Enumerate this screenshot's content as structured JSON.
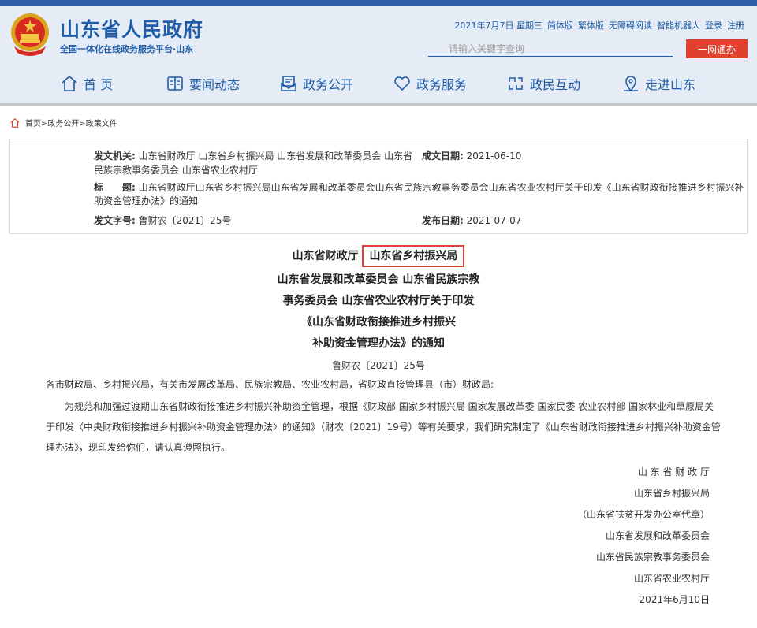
{
  "header": {
    "site_title": "山东省人民政府",
    "site_subtitle": "全国一体化在线政务服务平台·山东",
    "toplinks": [
      "2021年7月7日 星期三",
      "简体版",
      "繁体版",
      "无障碍阅读",
      "智能机器人",
      "登录",
      "注册"
    ],
    "search_placeholder": "请输入关键字查询",
    "search_button": "一网通办",
    "colors": {
      "brand": "#1f5da9",
      "accent": "#e0412f",
      "topbar": "#2e5da6"
    }
  },
  "nav": [
    {
      "label": "首 页",
      "icon": "home-icon"
    },
    {
      "label": "要闻动态",
      "icon": "newspaper-icon"
    },
    {
      "label": "政务公开",
      "icon": "document-open-icon"
    },
    {
      "label": "政务服务",
      "icon": "heart-icon"
    },
    {
      "label": "政民互动",
      "icon": "interaction-icon"
    },
    {
      "label": "走进山东",
      "icon": "map-pin-icon"
    }
  ],
  "breadcrumb": "首页>政务公开>政策文件",
  "meta": {
    "issuer_label": "发文机关:",
    "issuer": "山东省财政厅 山东省乡村振兴局 山东省发展和改革委员会 山东省民族宗教事务委员会 山东省农业农村厅",
    "date_label": "成文日期:",
    "date": "2021-06-10",
    "title_label": "标　　题:",
    "title": "山东省财政厅山东省乡村振兴局山东省发展和改革委员会山东省民族宗教事务委员会山东省农业农村厅关于印发《山东省财政衔接推进乡村振兴补助资金管理办法》的通知",
    "number_label": "发文字号:",
    "number": "鲁财农〔2021〕25号",
    "publish_label": "发布日期:",
    "publish": "2021-07-07"
  },
  "document": {
    "title_part1": "山东省财政厅",
    "title_highlight": "山东省乡村振兴局",
    "title_line2": "山东省发展和改革委员会 山东省民族宗教",
    "title_line3": "事务委员会 山东省农业农村厅关于印发",
    "title_line4": "《山东省财政衔接推进乡村振兴",
    "title_line5": "补助资金管理办法》的通知",
    "doc_no": "鲁财农〔2021〕25号",
    "salutation": "各市财政局、乡村振兴局，有关市发展改革局、民族宗教局、农业农村局，省财政直接管理县（市）财政局:",
    "paragraph": "为规范和加强过渡期山东省财政衔接推进乡村振兴补助资金管理，根据《财政部 国家乡村振兴局 国家发展改革委 国家民委 农业农村部 国家林业和草原局关于印发〈中央财政衔接推进乡村振兴补助资金管理办法〉的通知》（财农〔2021〕19号）等有关要求，我们研究制定了《山东省财政衔接推进乡村振兴补助资金管理办法》，现印发给你们，请认真遵照执行。",
    "signatures": [
      "山 东 省 财 政 厅",
      "山东省乡村振兴局",
      "（山东省扶贫开发办公室代章）",
      "山东省发展和改革委员会",
      "山东省民族宗教事务委员会",
      "山东省农业农村厅",
      "2021年6月10日"
    ]
  }
}
